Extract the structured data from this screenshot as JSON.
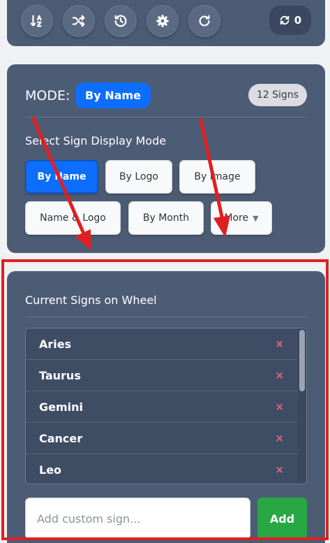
{
  "toolbar": {
    "buttons": [
      {
        "name": "sort-button",
        "icon": "sort-az-icon"
      },
      {
        "name": "shuffle-button",
        "icon": "shuffle-icon"
      },
      {
        "name": "history-button",
        "icon": "history-icon"
      },
      {
        "name": "settings-button",
        "icon": "gear-icon"
      },
      {
        "name": "reset-button",
        "icon": "redo-icon"
      }
    ],
    "spin_count": "0",
    "spin_count_icon": "sync-icon"
  },
  "mode_panel": {
    "mode_label": "MODE:",
    "mode_value": "By Name",
    "signs_count": "12 Signs",
    "section_title": "Select Sign Display Mode",
    "options": [
      {
        "label": "By Name",
        "active": true
      },
      {
        "label": "By Logo",
        "active": false
      },
      {
        "label": "By Image",
        "active": false
      },
      {
        "label": "Name & Logo",
        "active": false
      },
      {
        "label": "By Month",
        "active": false
      },
      {
        "label": "More",
        "active": false
      }
    ]
  },
  "signs_panel": {
    "title": "Current Signs on Wheel",
    "signs": [
      "Aries",
      "Taurus",
      "Gemini",
      "Cancer",
      "Leo"
    ],
    "remove_symbol": "×",
    "input_placeholder": "Add custom sign...",
    "add_label": "Add"
  },
  "colors": {
    "panel": "#4d5c75",
    "primary": "#0d6efd",
    "success": "#28a745",
    "annotation": "#e02020"
  }
}
